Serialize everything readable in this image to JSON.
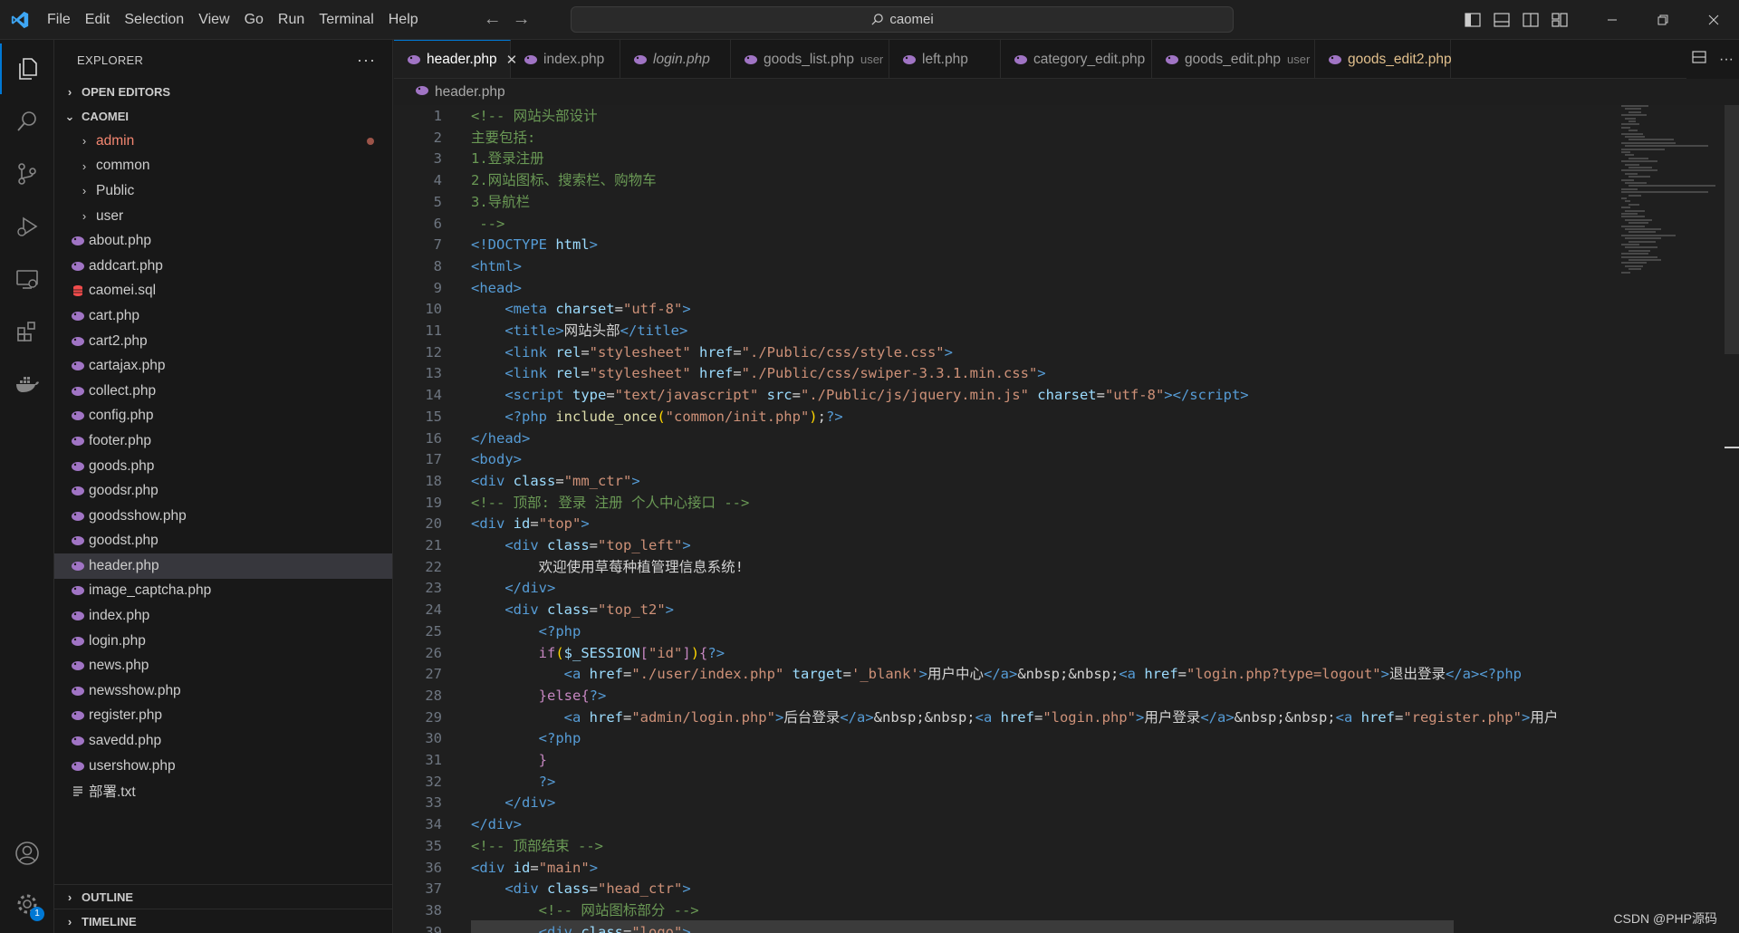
{
  "menu": [
    "File",
    "Edit",
    "Selection",
    "View",
    "Go",
    "Run",
    "Terminal",
    "Help"
  ],
  "command_center": {
    "text": "caomei"
  },
  "explorer": {
    "title": "EXPLORER",
    "more": "···",
    "open_editors": "OPEN EDITORS",
    "root": "CAOMEI",
    "folders": [
      "admin",
      "common",
      "Public",
      "user"
    ],
    "files": [
      "about.php",
      "addcart.php",
      "caomei.sql",
      "cart.php",
      "cart2.php",
      "cartajax.php",
      "collect.php",
      "config.php",
      "footer.php",
      "goods.php",
      "goodsr.php",
      "goodsshow.php",
      "goodst.php",
      "header.php",
      "image_captcha.php",
      "index.php",
      "login.php",
      "news.php",
      "newsshow.php",
      "register.php",
      "savedd.php",
      "usershow.php",
      "部署.txt"
    ],
    "selected_file": "header.php",
    "outline": "OUTLINE",
    "timeline": "TIMELINE"
  },
  "tabs": [
    {
      "label": "header.php",
      "desc": "",
      "active": true,
      "close": "✕"
    },
    {
      "label": "index.php",
      "desc": ""
    },
    {
      "label": "login.php",
      "desc": "",
      "italic": true
    },
    {
      "label": "goods_list.php",
      "desc": "user"
    },
    {
      "label": "left.php",
      "desc": ""
    },
    {
      "label": "category_edit.php",
      "desc": ""
    },
    {
      "label": "goods_edit.php",
      "desc": "user"
    },
    {
      "label": "goods_edit2.php",
      "desc": "",
      "modified": true
    }
  ],
  "breadcrumb": {
    "file": "header.php"
  },
  "code_lines": [
    "1",
    "2",
    "3",
    "4",
    "5",
    "6",
    "7",
    "8",
    "9",
    "10",
    "11",
    "12",
    "13",
    "14",
    "15",
    "16",
    "17",
    "18",
    "19",
    "20",
    "21",
    "22",
    "23",
    "24",
    "25",
    "26",
    "27",
    "28",
    "29",
    "30",
    "31",
    "32",
    "33",
    "34",
    "35",
    "36",
    "37",
    "38",
    "39"
  ],
  "badge": "1",
  "watermark": "CSDN @PHP源码",
  "colors": {
    "accent": "#0078d4",
    "php_icon": "#a074c4",
    "sql_icon": "#f14c4c",
    "modified": "#e2c08d"
  }
}
